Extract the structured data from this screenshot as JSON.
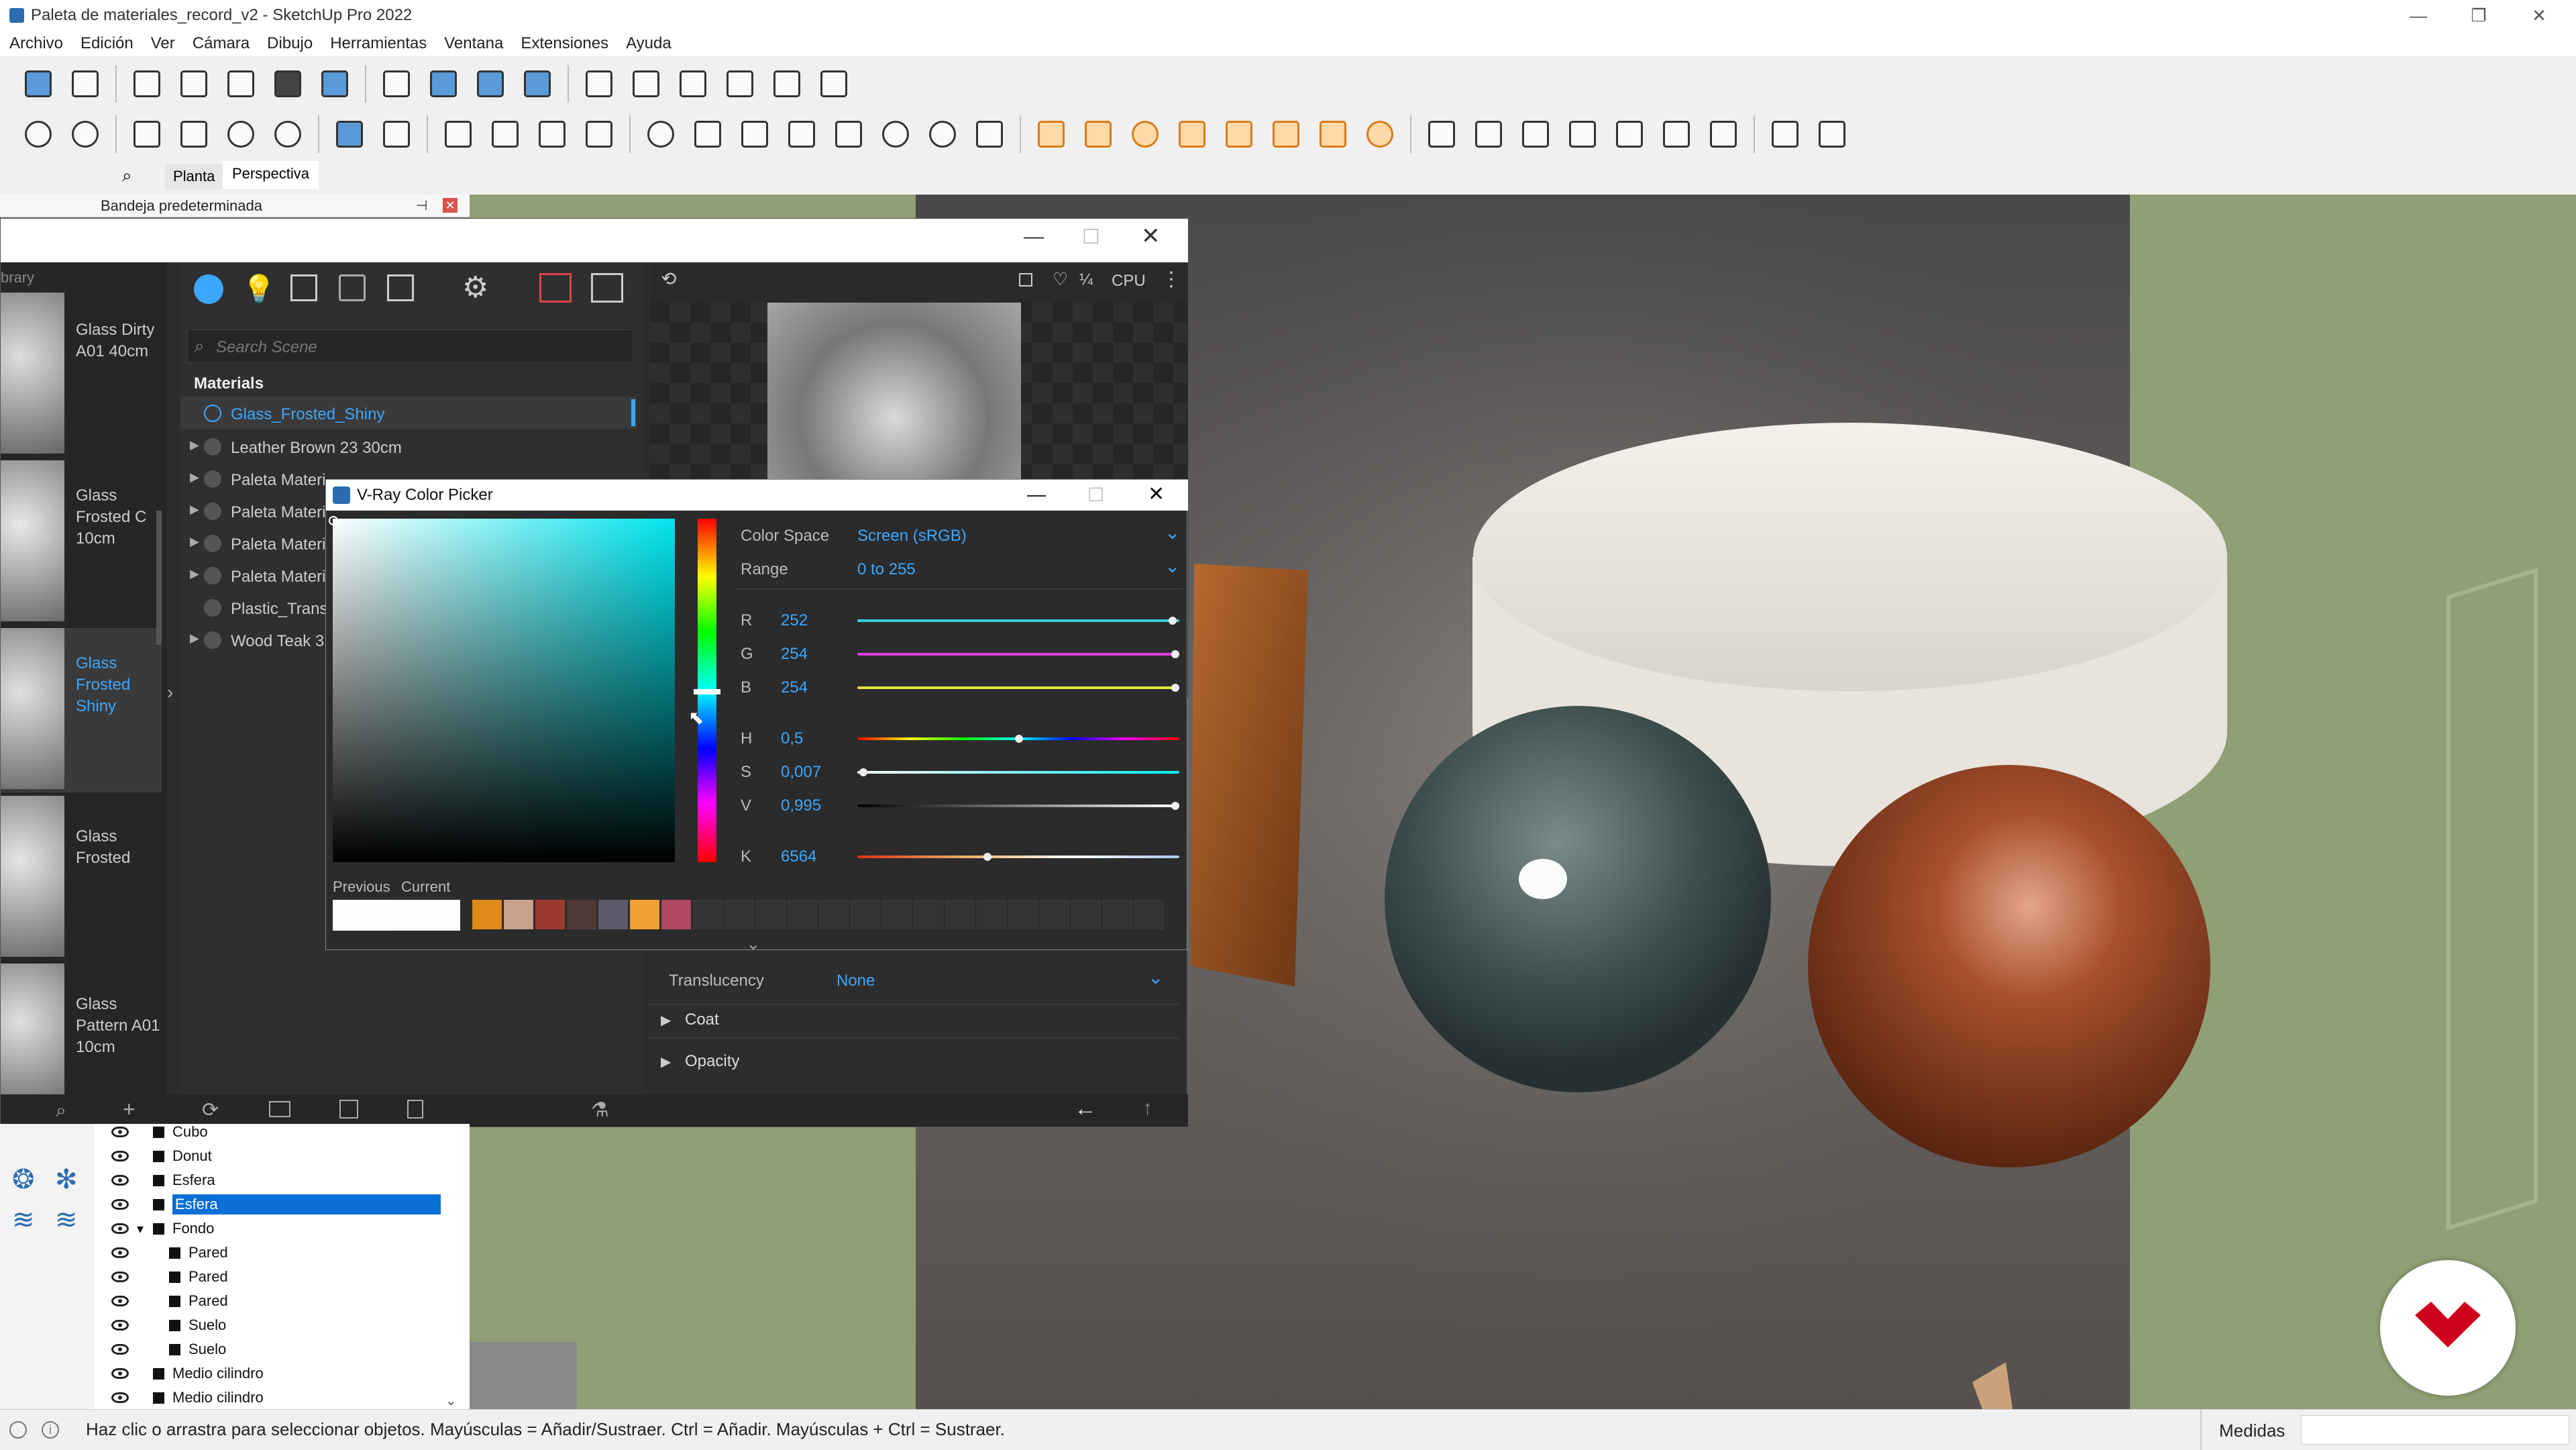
{
  "window": {
    "title": "Paleta de materiales_record_v2 - SketchUp Pro 2022",
    "controls": [
      "—",
      "❐",
      "✕"
    ]
  },
  "menu": [
    "Archivo",
    "Edición",
    "Ver",
    "Cámara",
    "Dibujo",
    "Herramientas",
    "Ventana",
    "Extensiones",
    "Ayuda"
  ],
  "scene_tabs": {
    "plan": "Planta",
    "persp": "Perspectiva"
  },
  "tray": {
    "title": "Bandeja predeterminada"
  },
  "vray": {
    "library_label": "brary",
    "library_items": [
      {
        "name": "Glass Dirty A01 40cm",
        "selected": false
      },
      {
        "name": "Glass Frosted C 10cm",
        "selected": false
      },
      {
        "name": "Glass Frosted Shiny",
        "selected": true
      },
      {
        "name": "Glass Frosted",
        "selected": false
      },
      {
        "name": "Glass Pattern A01 10cm",
        "selected": false
      }
    ],
    "search_placeholder": "Search Scene",
    "materials_header": "Materials",
    "materials": [
      "Glass_Frosted_Shiny",
      "Leather Brown 23 30cm",
      "Paleta Materi",
      "Paleta Materi",
      "Paleta Materi",
      "Paleta Materi",
      "Plastic_Transl",
      "Wood Teak 3"
    ],
    "renderer": "CPU",
    "translucency": {
      "label": "Translucency",
      "value": "None"
    },
    "sections": [
      "Coat",
      "Opacity"
    ]
  },
  "color_picker": {
    "title": "V-Ray Color Picker",
    "color_space": {
      "label": "Color Space",
      "value": "Screen (sRGB)"
    },
    "range": {
      "label": "Range",
      "value": "0 to 255"
    },
    "channels": [
      {
        "label": "R",
        "value": "252",
        "fraction": 0.988,
        "color": "#35d0e0"
      },
      {
        "label": "G",
        "value": "254",
        "fraction": 0.996,
        "color": "#e040e0"
      },
      {
        "label": "B",
        "value": "254",
        "fraction": 0.996,
        "color": "#e0e040"
      }
    ],
    "hsv": [
      {
        "label": "H",
        "value": "0,5",
        "fraction": 0.5
      },
      {
        "label": "S",
        "value": "0,007",
        "fraction": 0.007
      },
      {
        "label": "V",
        "value": "0,995",
        "fraction": 0.995
      }
    ],
    "kelvin": {
      "label": "K",
      "value": "6564",
      "fraction": 0.4
    },
    "previous_label": "Previous",
    "current_label": "Current",
    "swatches": [
      "#e08a1a",
      "#c8a08c",
      "#9b3a2e",
      "#4d3a35",
      "#5a5a6a",
      "#f0a030",
      "#b04a60"
    ]
  },
  "outliner": {
    "items": [
      {
        "label": "Cubo",
        "indent": 0,
        "selected": false
      },
      {
        "label": "Donut",
        "indent": 0,
        "selected": false
      },
      {
        "label": "Esfera",
        "indent": 0,
        "selected": false
      },
      {
        "label": "Esfera",
        "indent": 0,
        "selected": true
      },
      {
        "label": "Fondo",
        "indent": 0,
        "selected": false,
        "expanded": true
      },
      {
        "label": "Pared",
        "indent": 1,
        "selected": false
      },
      {
        "label": "Pared",
        "indent": 1,
        "selected": false
      },
      {
        "label": "Pared",
        "indent": 1,
        "selected": false
      },
      {
        "label": "Suelo",
        "indent": 1,
        "selected": false
      },
      {
        "label": "Suelo",
        "indent": 1,
        "selected": false
      },
      {
        "label": "Medio cilindro",
        "indent": 0,
        "selected": false
      },
      {
        "label": "Medio cilindro",
        "indent": 0,
        "selected": false
      }
    ]
  },
  "status": {
    "text": "Haz clic o arrastra para seleccionar objetos. Mayúsculas = Añadir/Sustraer. Ctrl = Añadir. Mayúsculas + Ctrl = Sustraer.",
    "measures_label": "Medidas"
  },
  "colors": {
    "accent": "#3ba7ff",
    "selection": "#0a6fd6",
    "vray_bg": "#2d2d2d"
  }
}
